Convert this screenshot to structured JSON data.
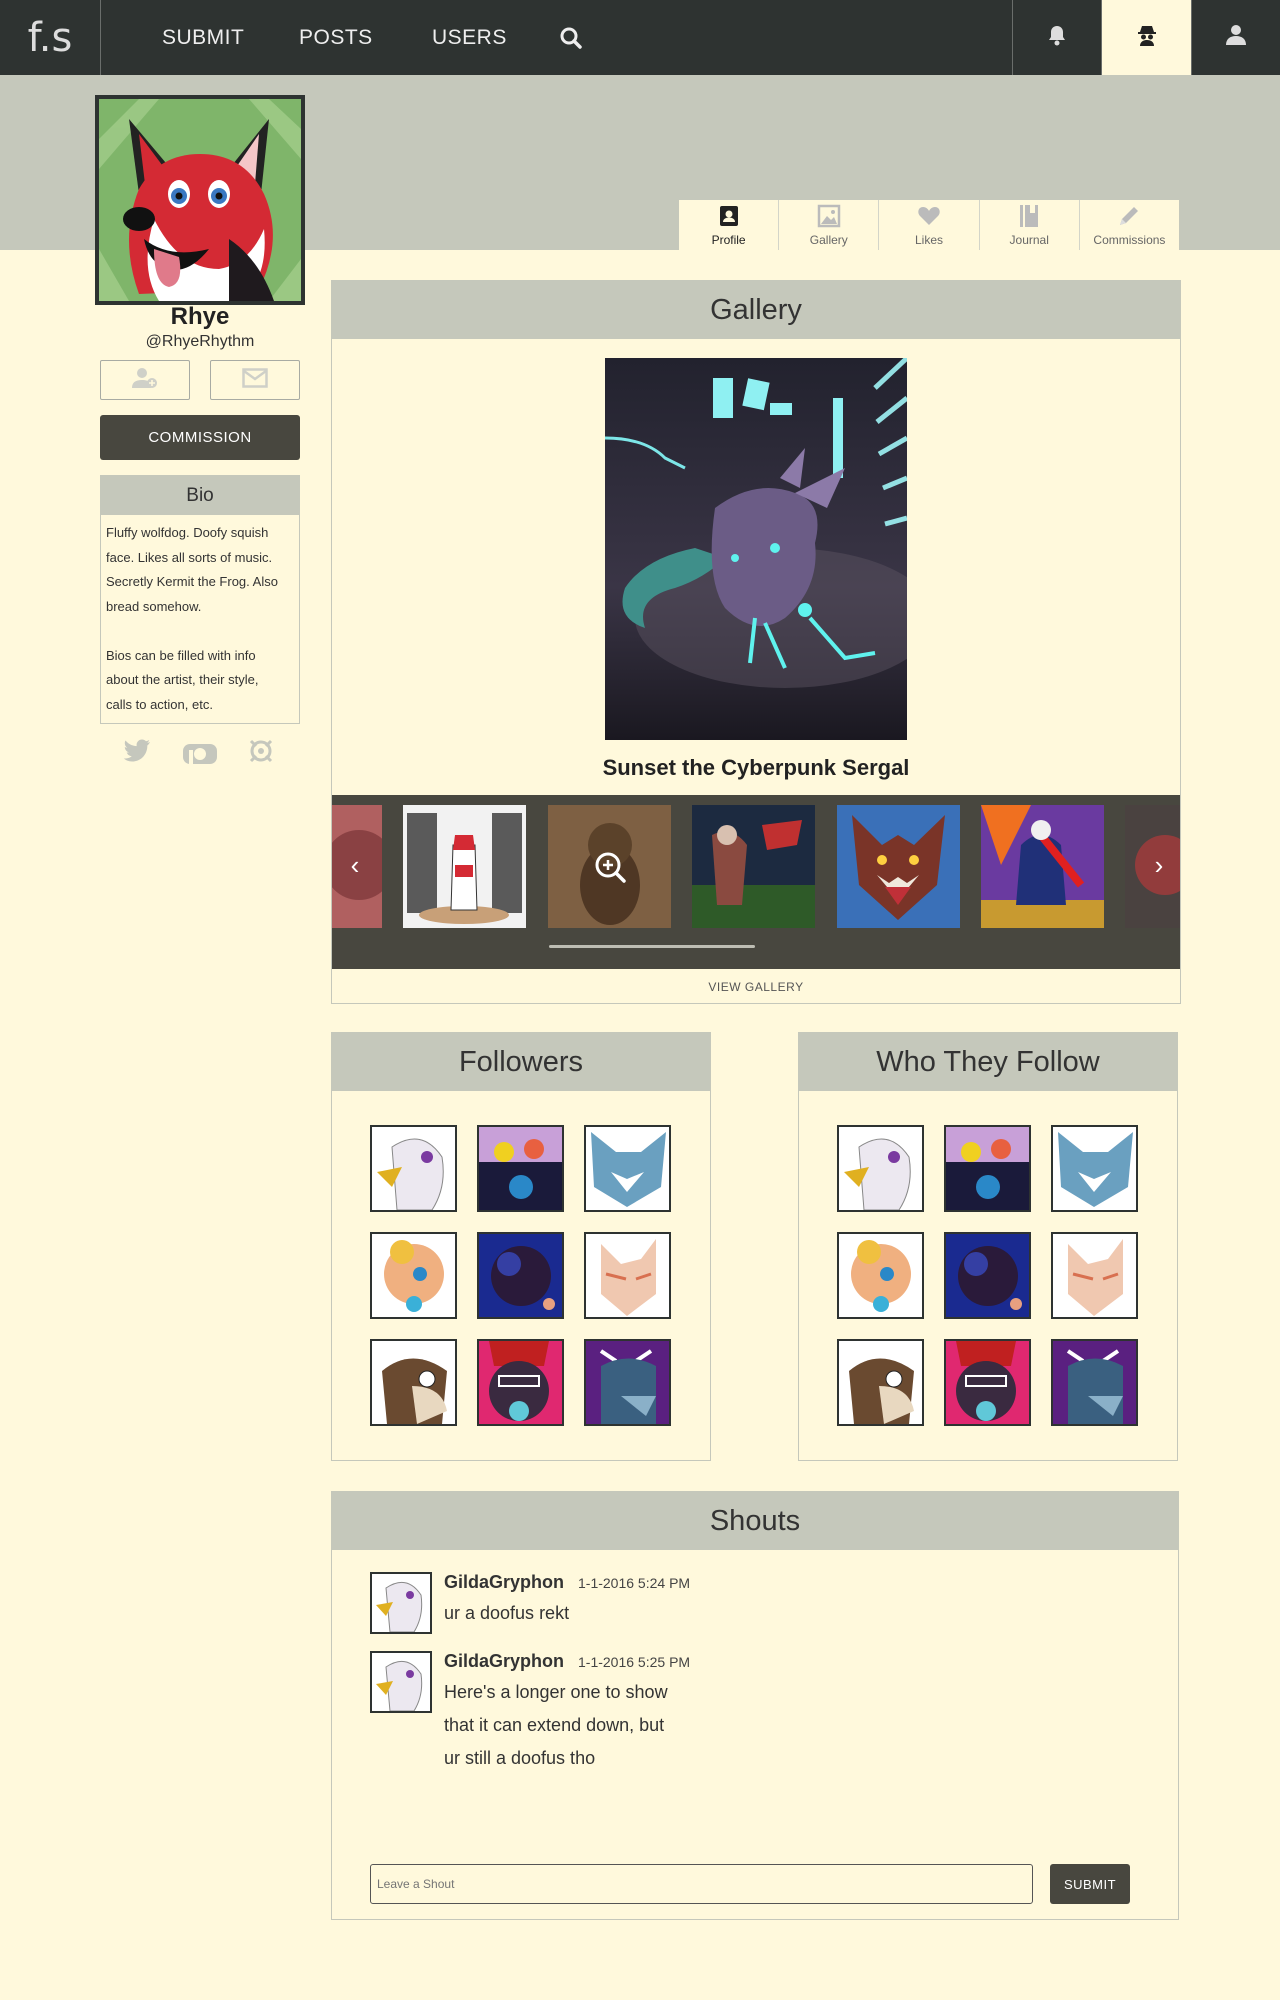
{
  "nav": {
    "logo": "f.s",
    "items": [
      "SUBMIT",
      "POSTS",
      "USERS"
    ],
    "icons": [
      "search-icon",
      "bell-icon",
      "incognito-icon",
      "user-icon"
    ]
  },
  "profile": {
    "name": "Rhye",
    "handle": "@RhyeRhythm",
    "commission_label": "COMMISSION",
    "bio_title": "Bio",
    "bio_lines": [
      "Fluffy wolfdog. Doofy squish",
      "face. Likes all sorts of music.",
      "Secretly Kermit the Frog. Also",
      "bread somehow.",
      "",
      "Bios can be filled with info",
      "about the artist, their style,",
      "calls to action, etc."
    ]
  },
  "tabs": [
    "Profile",
    "Gallery",
    "Likes",
    "Journal",
    "Commissions"
  ],
  "gallery": {
    "title": "Gallery",
    "featured_title": "Sunset the Cyberpunk Sergal",
    "view_all": "VIEW GALLERY"
  },
  "followers": {
    "title": "Followers"
  },
  "following": {
    "title": "Who They Follow"
  },
  "shouts": {
    "title": "Shouts",
    "items": [
      {
        "user": "GildaGryphon",
        "date": "1-1-2016 5:24 PM",
        "lines": [
          "ur a doofus rekt"
        ]
      },
      {
        "user": "GildaGryphon",
        "date": "1-1-2016 5:25 PM",
        "lines": [
          "Here's a longer one to show",
          "that it can extend down, but",
          "ur still a doofus tho"
        ]
      }
    ],
    "placeholder": "Leave a Shout",
    "submit_label": "SUBMIT"
  },
  "colors": {
    "header": "#2e3331",
    "accent_bg": "#c5c8bb",
    "page_bg": "#fff9dc",
    "button": "#48473f"
  }
}
